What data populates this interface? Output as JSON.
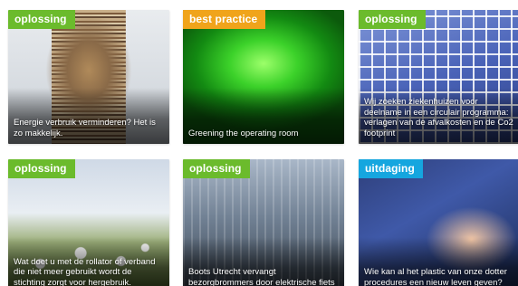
{
  "colors": {
    "oplossing": "#6bbb2c",
    "best_practice": "#f0a41b",
    "uitdaging": "#15a6df"
  },
  "cards": [
    {
      "badge": "oplossing",
      "caption": "Energie verbruik verminderen? Het is zo makkelijk."
    },
    {
      "badge": "best practice",
      "caption": "Greening the operating room"
    },
    {
      "badge": "oplossing",
      "caption": "Wij zoeken ziekenhuizen voor deelname in een circulair programma: verlagen van de afvalkosten en de Co2 footprint"
    },
    {
      "badge": "oplossing",
      "caption": "Wat doet u met de rollator of verband die niet meer gebruikt wordt de stichting zorgt voor hergebruik."
    },
    {
      "badge": "oplossing",
      "caption": "Boots Utrecht vervangt bezorgbrommers door elektrische fiets"
    },
    {
      "badge": "uitdaging",
      "caption": "Wie kan al het plastic van onze dotter procedures een nieuw leven geven?"
    }
  ]
}
